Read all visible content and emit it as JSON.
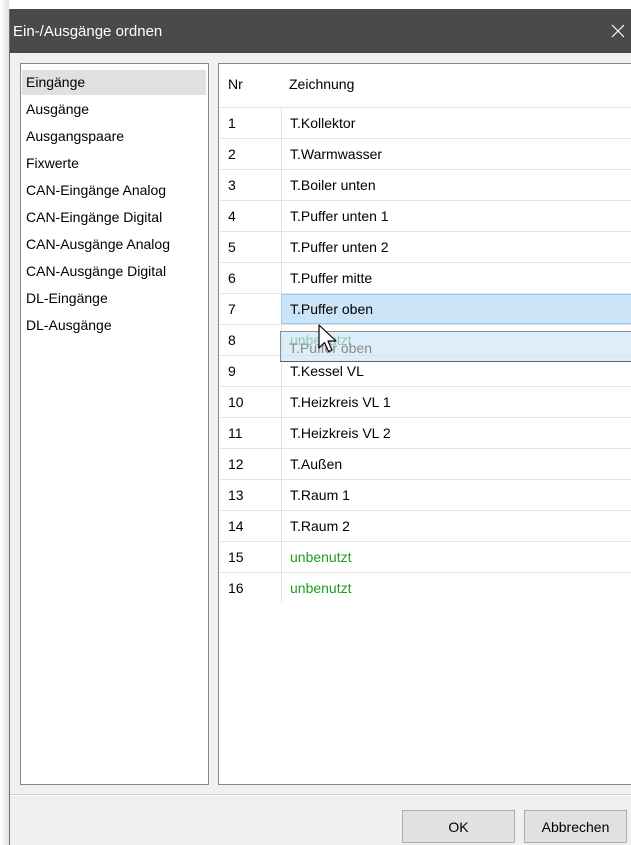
{
  "window": {
    "title": "Ein-/Ausgänge ordnen"
  },
  "sidebar": {
    "items": [
      {
        "label": "Eingänge",
        "selected": true
      },
      {
        "label": "Ausgänge"
      },
      {
        "label": "Ausgangspaare"
      },
      {
        "label": "Fixwerte"
      },
      {
        "label": "CAN-Eingänge Analog"
      },
      {
        "label": "CAN-Eingänge Digital"
      },
      {
        "label": "CAN-Ausgänge Analog"
      },
      {
        "label": "CAN-Ausgänge Digital"
      },
      {
        "label": "DL-Eingänge"
      },
      {
        "label": "DL-Ausgänge"
      }
    ]
  },
  "table": {
    "headers": {
      "nr": "Nr",
      "name": "Zeichnung"
    },
    "rows": [
      {
        "nr": "1",
        "name": "T.Kollektor"
      },
      {
        "nr": "2",
        "name": "T.Warmwasser"
      },
      {
        "nr": "3",
        "name": "T.Boiler unten"
      },
      {
        "nr": "4",
        "name": "T.Puffer unten 1"
      },
      {
        "nr": "5",
        "name": "T.Puffer unten 2"
      },
      {
        "nr": "6",
        "name": "T.Puffer mitte"
      },
      {
        "nr": "7",
        "name": "T.Puffer oben",
        "selected": true
      },
      {
        "nr": "8",
        "name": "unbenutzt",
        "unused": true
      },
      {
        "nr": "9",
        "name": "T.Kessel VL"
      },
      {
        "nr": "10",
        "name": "T.Heizkreis VL 1"
      },
      {
        "nr": "11",
        "name": "T.Heizkreis VL 2"
      },
      {
        "nr": "12",
        "name": "T.Außen"
      },
      {
        "nr": "13",
        "name": "T.Raum 1"
      },
      {
        "nr": "14",
        "name": "T.Raum 2"
      },
      {
        "nr": "15",
        "name": "unbenutzt",
        "unused": true
      },
      {
        "nr": "16",
        "name": "unbenutzt",
        "unused": true
      }
    ]
  },
  "drag": {
    "label": "T.Puffer oben"
  },
  "buttons": {
    "ok": "OK",
    "cancel": "Abbrechen"
  },
  "colors": {
    "titlebar": "#4a4a4a",
    "unused_text": "#1e9c1e",
    "selection": "#cce4f7",
    "sidebar_selection": "#e0e0e0"
  },
  "icons": {
    "close": "close-icon",
    "cursor": "mouse-pointer-icon"
  }
}
